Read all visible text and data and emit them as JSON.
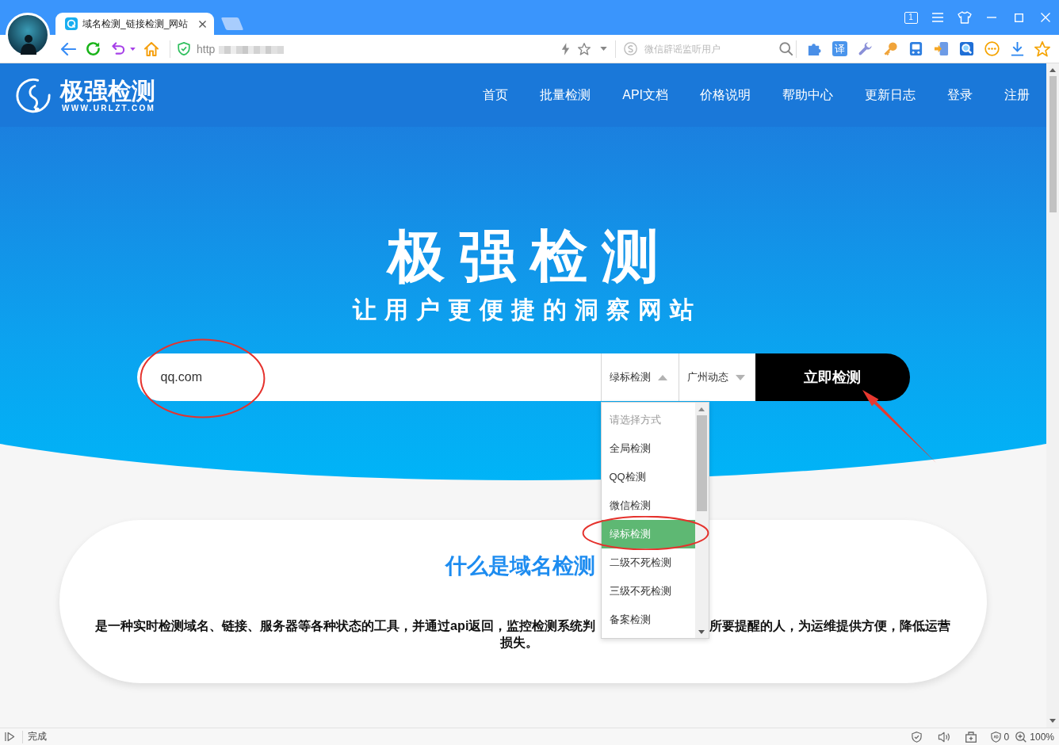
{
  "browser": {
    "tabs": [
      {
        "title": "域名检测_链接检测_网站",
        "selected": true
      }
    ],
    "tab_count": "1",
    "address": {
      "value": "http",
      "redacted": true
    },
    "search": {
      "placeholder": "微信辟谣监听用户"
    },
    "translate_label": "译"
  },
  "site": {
    "logo": {
      "name": "极强检测",
      "domain": "WWW.URLZT.COM"
    },
    "nav": [
      "首页",
      "批量检测",
      "API文档",
      "价格说明",
      "帮助中心",
      "更新日志",
      "登录",
      "注册"
    ]
  },
  "hero": {
    "title": "极强检测",
    "subtitle": "让用户更便捷的洞察网站"
  },
  "search_form": {
    "input": {
      "value": "qq.com"
    },
    "selects": [
      {
        "value": "绿标检测",
        "expanded": true,
        "options": [
          {
            "label": "请选择方式",
            "kind": "placeholder",
            "selected": false
          },
          {
            "label": "全局检测",
            "kind": "option",
            "selected": false
          },
          {
            "label": "QQ检测",
            "kind": "option",
            "selected": false
          },
          {
            "label": "微信检测",
            "kind": "option",
            "selected": false
          },
          {
            "label": "绿标检测",
            "kind": "option",
            "selected": true
          },
          {
            "label": "二级不死检测",
            "kind": "option",
            "selected": false
          },
          {
            "label": "三级不死检测",
            "kind": "option",
            "selected": false
          },
          {
            "label": "备案检测",
            "kind": "option",
            "selected": false
          }
        ]
      },
      {
        "value": "广州动态",
        "expanded": false
      }
    ],
    "submit": "立即检测"
  },
  "card": {
    "title": "什么是域名检测",
    "description": [
      {
        "segments": [
          "是一种实时检测域名、链接、服务器等各种状态的工具，并通过api返回，监控检测系统判",
          "所要提醒的人，为运维提供方便，降低运营"
        ]
      },
      {
        "segments": [
          "损失。"
        ]
      }
    ]
  },
  "status_bar": {
    "text": "完成",
    "blocked_count": "0",
    "zoom": "100%"
  },
  "annotations": [
    {
      "kind": "ellipse"
    },
    {
      "kind": "ellipse"
    },
    {
      "kind": "arrow"
    }
  ]
}
